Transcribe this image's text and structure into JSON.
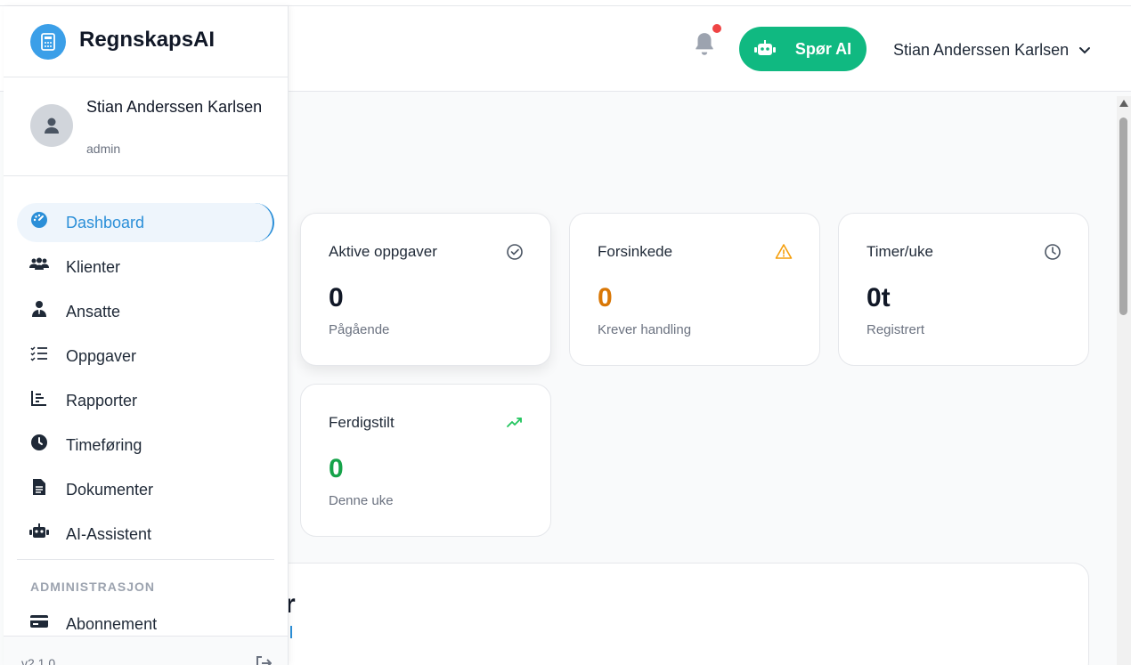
{
  "brand": {
    "name": "RegnskapsAI"
  },
  "header": {
    "ask_ai_label": "Spør AI",
    "user_name": "Stian Anderssen Karlsen"
  },
  "profile": {
    "name": "Stian Anderssen Karlsen",
    "role": "admin"
  },
  "nav": {
    "items": [
      {
        "label": "Dashboard",
        "icon": "dashboard-icon",
        "active": true
      },
      {
        "label": "Klienter",
        "icon": "users-icon"
      },
      {
        "label": "Ansatte",
        "icon": "employee-icon"
      },
      {
        "label": "Oppgaver",
        "icon": "task-list-icon"
      },
      {
        "label": "Rapporter",
        "icon": "chart-icon"
      },
      {
        "label": "Timeføring",
        "icon": "clock-icon"
      },
      {
        "label": "Dokumenter",
        "icon": "document-icon"
      },
      {
        "label": "AI-Assistent",
        "icon": "robot-icon"
      }
    ],
    "section_admin": "ADMINISTRASJON",
    "admin_items": [
      {
        "label": "Abonnement",
        "icon": "credit-card-icon"
      }
    ]
  },
  "footer": {
    "version": "v2.1.0"
  },
  "stats": [
    {
      "title": "Aktive oppgaver",
      "value": "0",
      "subtitle": "Pågående",
      "icon": "check-circle-icon",
      "color": "#111827"
    },
    {
      "title": "Forsinkede",
      "value": "0",
      "subtitle": "Krever handling",
      "icon": "warning-icon",
      "color": "#d97706"
    },
    {
      "title": "Timer/uke",
      "value": "0t",
      "subtitle": "Registrert",
      "icon": "clock-icon",
      "color": "#111827"
    },
    {
      "title": "Ferdigstilt",
      "value": "0",
      "subtitle": "Denne uke",
      "icon": "trending-up-icon",
      "color": "#16a34a"
    }
  ],
  "panel": {
    "peek_text": "r"
  },
  "colors": {
    "accent": "#2b8fd8",
    "success": "#10b981",
    "warning": "#d97706",
    "notification": "#ef4444"
  }
}
